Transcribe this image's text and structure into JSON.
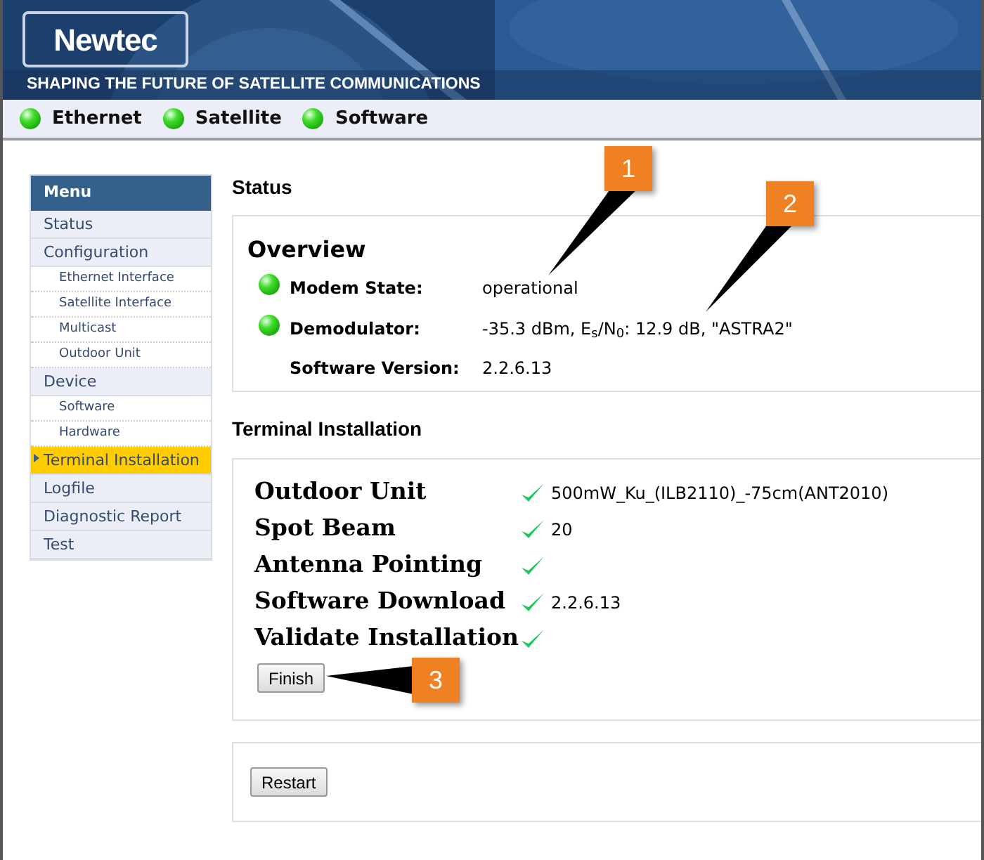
{
  "header": {
    "logo": "Newtec",
    "tagline": "SHAPING THE FUTURE OF SATELLITE COMMUNICATIONS"
  },
  "indicators": [
    {
      "label": "Ethernet",
      "ok": true
    },
    {
      "label": "Satellite",
      "ok": true
    },
    {
      "label": "Software",
      "ok": true
    }
  ],
  "sidebar": {
    "title": "Menu",
    "items": [
      {
        "label": "Status",
        "kind": "top",
        "selected": false
      },
      {
        "label": "Configuration",
        "kind": "top",
        "selected": false
      },
      {
        "label": "Ethernet Interface",
        "kind": "sub",
        "selected": false
      },
      {
        "label": "Satellite Interface",
        "kind": "sub",
        "selected": false
      },
      {
        "label": "Multicast",
        "kind": "sub",
        "selected": false
      },
      {
        "label": "Outdoor Unit",
        "kind": "sub",
        "selected": false
      },
      {
        "label": "Device",
        "kind": "top",
        "selected": false
      },
      {
        "label": "Software",
        "kind": "sub",
        "selected": false
      },
      {
        "label": "Hardware",
        "kind": "sub",
        "selected": false
      },
      {
        "label": "Terminal Installation",
        "kind": "top",
        "selected": true
      },
      {
        "label": "Logfile",
        "kind": "top",
        "selected": false
      },
      {
        "label": "Diagnostic Report",
        "kind": "top",
        "selected": false
      },
      {
        "label": "Test",
        "kind": "top",
        "selected": false
      }
    ]
  },
  "status": {
    "title": "Status",
    "overview_title": "Overview",
    "rows": [
      {
        "label": "Modem State:",
        "value": "operational",
        "ok": true
      },
      {
        "label": "Demodulator:",
        "value": "-35.3 dBm, E$_{s}$/N$_{0}$: 12.9 dB, \"ASTRA2\"",
        "ok": true
      },
      {
        "label": "Software Version:",
        "value": "2.2.6.13"
      }
    ]
  },
  "installation": {
    "title": "Terminal Installation",
    "steps": [
      {
        "label": "Outdoor Unit",
        "done": true,
        "value": "500mW_Ku_(ILB2110)_-75cm(ANT2010)"
      },
      {
        "label": "Spot Beam",
        "done": true,
        "value": "20"
      },
      {
        "label": "Antenna Pointing",
        "done": true
      },
      {
        "label": "Software Download",
        "done": true,
        "value": "2.2.6.13"
      },
      {
        "label": "Validate Installation",
        "done": true
      }
    ],
    "finish_button": "Finish",
    "restart_button": "Restart"
  },
  "callouts": [
    "1",
    "2",
    "3"
  ]
}
